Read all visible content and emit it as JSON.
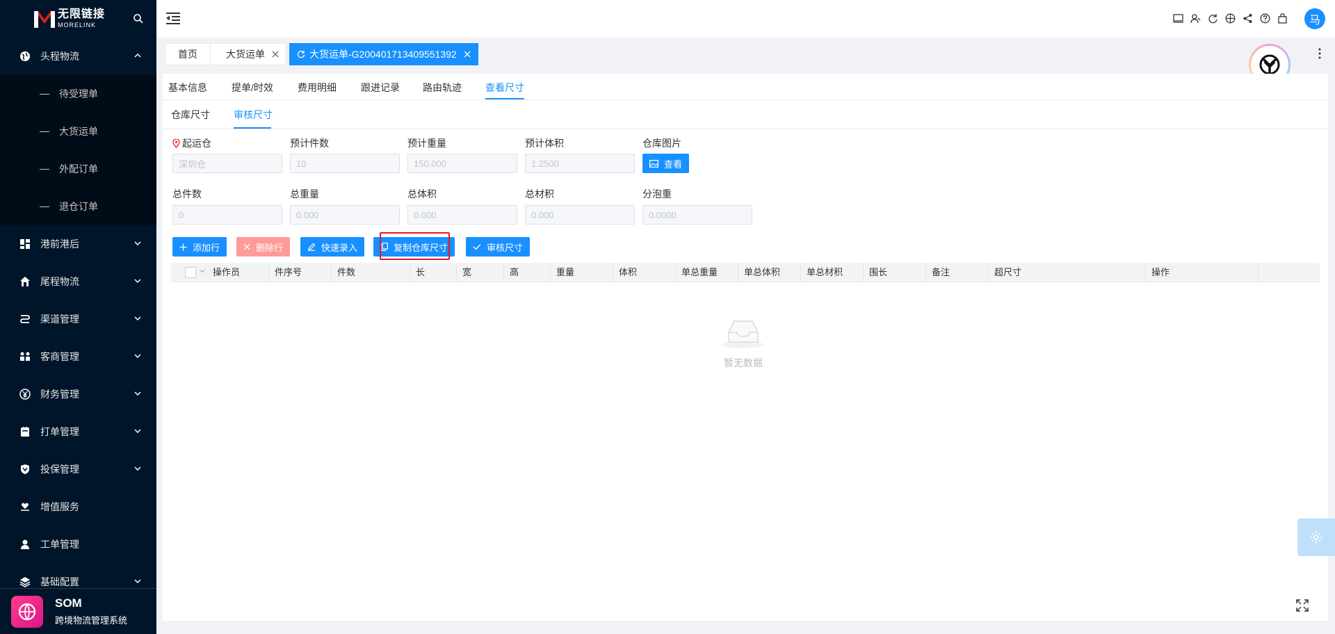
{
  "brand": {
    "name_cn": "无限链接",
    "name_en": "MORELINK"
  },
  "sidebar": {
    "items": [
      {
        "label": "头程物流",
        "icon": "globe-icon",
        "expanded": true,
        "children": [
          "待受理单",
          "大货运单",
          "外配订单",
          "退仓订单"
        ]
      },
      {
        "label": "港前港后",
        "icon": "dashboard-icon"
      },
      {
        "label": "尾程物流",
        "icon": "home-icon"
      },
      {
        "label": "渠道管理",
        "icon": "route-icon"
      },
      {
        "label": "客商管理",
        "icon": "users-icon"
      },
      {
        "label": "财务管理",
        "icon": "yen-icon"
      },
      {
        "label": "打单管理",
        "icon": "print-icon"
      },
      {
        "label": "投保管理",
        "icon": "shield-icon"
      },
      {
        "label": "增值服务",
        "icon": "heart-hand-icon"
      },
      {
        "label": "工单管理",
        "icon": "user-icon"
      },
      {
        "label": "基础配置",
        "icon": "layers-icon"
      }
    ],
    "footer": {
      "title": "SOM",
      "subtitle": "跨境物流管理系统"
    }
  },
  "header": {
    "avatar": "马"
  },
  "tabs": [
    {
      "label": "首页"
    },
    {
      "label": "大货运单"
    },
    {
      "label": "大货运单-G200401713409551392",
      "active": true
    }
  ],
  "detail_tabs": [
    "基本信息",
    "提单/时效",
    "费用明细",
    "跟进记录",
    "路由轨迹",
    "查看尺寸"
  ],
  "detail_tab_active": "查看尺寸",
  "size_tabs": [
    "仓库尺寸",
    "审核尺寸"
  ],
  "size_tab_active": "审核尺寸",
  "form": {
    "row1": [
      {
        "label": "起运仓",
        "value": "深圳仓",
        "has_pin": true
      },
      {
        "label": "预计件数",
        "value": "10"
      },
      {
        "label": "预计重量",
        "value": "150.000"
      },
      {
        "label": "预计体积",
        "value": "1.2500"
      },
      {
        "label": "仓库图片",
        "button": "查看"
      }
    ],
    "row2": [
      {
        "label": "总件数",
        "value": "0"
      },
      {
        "label": "总重量",
        "value": "0.000"
      },
      {
        "label": "总体积",
        "value": "0.000"
      },
      {
        "label": "总材积",
        "value": "0.000"
      },
      {
        "label": "分泡重",
        "value": "0.0000"
      }
    ]
  },
  "actions": {
    "add_row": "添加行",
    "delete_row": "删除行",
    "quick_entry": "快速录入",
    "copy_size": "复制仓库尺寸",
    "audit_size": "审核尺寸"
  },
  "table": {
    "columns": [
      "操作员",
      "件序号",
      "件数",
      "长",
      "宽",
      "高",
      "重量",
      "体积",
      "单总重量",
      "单总体积",
      "单总材积",
      "围长",
      "备注",
      "超尺寸",
      "操作"
    ],
    "empty_text": "暂无数据"
  },
  "colors": {
    "sidebar_bg": "#001529",
    "primary": "#1890ff",
    "danger_light": "#ff9a9a",
    "highlight": "#e8191b"
  }
}
